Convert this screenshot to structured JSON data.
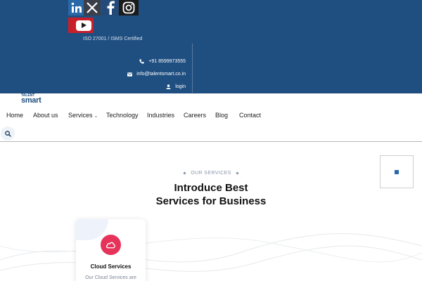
{
  "topbar": {
    "social": [
      "linkedin-icon",
      "x-icon",
      "facebook-icon",
      "instagram-icon",
      "youtube-icon"
    ],
    "certification": "ISO 27001 / ISMS Certified",
    "phone": "+91 8599973555",
    "email": "info@talentsmart.co.in",
    "login": "login",
    "background_color": "#1f4e80"
  },
  "logo": {
    "small": "TALENT",
    "big": "smart"
  },
  "nav": {
    "items": [
      "Home",
      "About us",
      "Services",
      "Technology",
      "Industries",
      "Careers",
      "Blog",
      "Contact"
    ]
  },
  "section": {
    "eyebrow": "OUR SERVICES",
    "title_line1": "Introduce Best",
    "title_line2": "Services for Business"
  },
  "card": {
    "title": "Cloud Services",
    "text": "Our Cloud Services are",
    "icon": "cloud-icon",
    "icon_color": "#e5335a"
  }
}
